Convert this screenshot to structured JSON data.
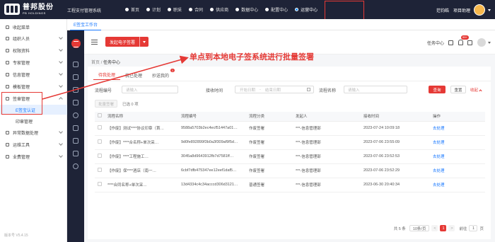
{
  "topbar": {
    "logo": {
      "name": "普邦股份",
      "sub": "PB HOLDINGS"
    },
    "system_title": "工程支付管理系统",
    "nav": [
      {
        "label": "首页",
        "active": false
      },
      {
        "label": "计划",
        "active": false
      },
      {
        "label": "职采",
        "active": false
      },
      {
        "label": "合同",
        "active": false
      },
      {
        "label": "供应商",
        "active": false
      },
      {
        "label": "数据中心",
        "active": false
      },
      {
        "label": "配置中心",
        "active": false
      },
      {
        "label": "运营中心",
        "active": true
      }
    ],
    "user": {
      "name": "范钧皓",
      "role": "项目助理"
    }
  },
  "sidebar": {
    "items": [
      {
        "label": "收起菜单",
        "icon": "collapse-icon"
      },
      {
        "label": "组织人员",
        "icon": "org-icon"
      },
      {
        "label": "权限资料",
        "icon": "auth-icon"
      },
      {
        "label": "专家管理",
        "icon": "expert-icon"
      },
      {
        "label": "信息管理",
        "icon": "info-icon"
      },
      {
        "label": "模板管理",
        "icon": "template-icon"
      },
      {
        "label": "签章管理",
        "icon": "seal-icon"
      },
      {
        "label": "E签宝认证",
        "sub": true,
        "active": true
      },
      {
        "label": "印章管理",
        "sub": true
      },
      {
        "label": "异常数据处理",
        "icon": "warning-icon"
      },
      {
        "label": "运维工具",
        "icon": "tool-icon"
      },
      {
        "label": "业费管理",
        "icon": "fee-icon"
      }
    ],
    "version": "版本号 V5.4.15"
  },
  "tabstrip": {
    "label": "E签宝工作台"
  },
  "workspace": {
    "launch_button": "发起电子签署",
    "task_center": "任务中心",
    "bell_badge": "99+"
  },
  "breadcrumb": {
    "home": "首页",
    "current": "任务中心"
  },
  "tabs": [
    {
      "label": "待我处理",
      "active": true
    },
    {
      "label": "我已处理",
      "active": false
    },
    {
      "label": "抄送我的",
      "active": false,
      "badge": "1"
    }
  ],
  "filters": {
    "process_no_label": "流程编号",
    "process_no_placeholder": "请输入",
    "receive_time_label": "接收时间",
    "date_start": "开始日期",
    "date_sep": "-",
    "date_end": "结束日期",
    "process_name_label": "流程名称",
    "process_name_placeholder": "请输入",
    "search": "查询",
    "reset": "重置",
    "collapse": "收起"
  },
  "batch": {
    "button": "批量签署",
    "selected": "已选 0 项"
  },
  "table": {
    "columns": [
      "流程名称",
      "流程编号",
      "流程分类",
      "发起人",
      "接收时间",
      "操作"
    ],
    "rows": [
      {
        "name": "【作废】测试****协议印章（首…",
        "no": "9588a5703b2ec4ecf51447a01…",
        "category": "作废签署",
        "sender": "***-信息管理部",
        "time": "2023-07-24 10:09:18",
        "action": "去处理"
      },
      {
        "name": "【作废】****合名称+单次采…",
        "no": "9d0fe892899f3b0a3f309af9f5d…",
        "category": "作废签署",
        "sender": "***-信息管理部",
        "time": "2023-07-06 23:55:09",
        "action": "去处理"
      },
      {
        "name": "【作废】****工程施工…",
        "no": "3045a8d9643912fb7d7581ff…",
        "category": "作废签署",
        "sender": "***-信息管理部",
        "time": "2023-07-06 23:52:53",
        "action": "去处理"
      },
      {
        "name": "【作废】保****酒店（南一…",
        "no": "6cbf7dfb475347ee12eef1daf5…",
        "category": "作废签署",
        "sender": "***-信息管理部",
        "time": "2023-07-06 23:52:29",
        "action": "去处理"
      },
      {
        "name": "****合同名称+单次采…",
        "no": "13d4334c4c34acccd306d3121…",
        "category": "普通签署",
        "sender": "***-信息管理部",
        "time": "2023-06-30 20:40:34",
        "action": "去处理"
      }
    ]
  },
  "pagination": {
    "total": "共 5 条",
    "page_size": "10条/页",
    "prev": "<",
    "page": "1",
    "next": ">",
    "goto_label": "前往",
    "goto_value": "1",
    "goto_unit": "页"
  },
  "annotation": {
    "text": "单点到本地电子签系统进行批量签署",
    "color": "#e53935"
  },
  "colors": {
    "brand_red": "#e53935",
    "topbar": "#1e2337",
    "link_blue": "#1677ff"
  }
}
